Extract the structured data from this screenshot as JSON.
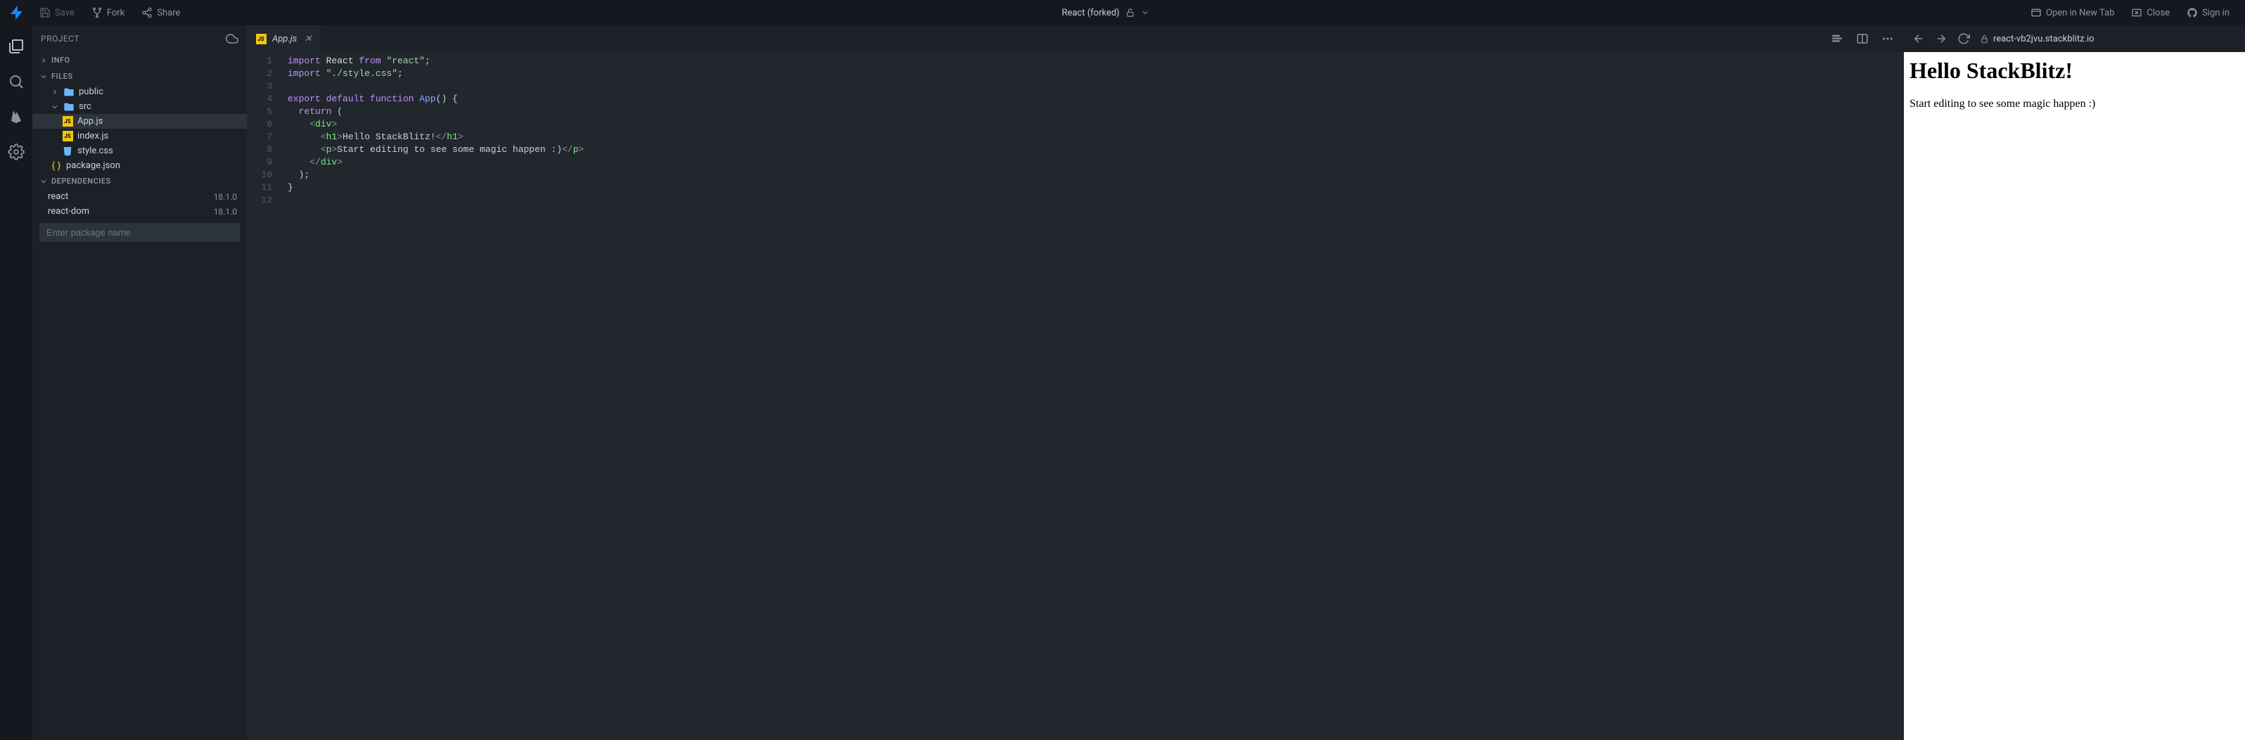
{
  "topbar": {
    "save": "Save",
    "fork": "Fork",
    "share": "Share",
    "project_title": "React (forked)",
    "open_new_tab": "Open in New Tab",
    "close": "Close",
    "signin": "Sign in"
  },
  "sidebar": {
    "header": "PROJECT",
    "sections": {
      "info": "INFO",
      "files": "FILES",
      "deps": "DEPENDENCIES"
    },
    "tree": {
      "public": "public",
      "src": "src",
      "app_js": "App.js",
      "index_js": "index.js",
      "style_css": "style.css",
      "package_json": "package.json"
    },
    "deps": [
      {
        "name": "react",
        "version": "18.1.0"
      },
      {
        "name": "react-dom",
        "version": "18.1.0"
      }
    ],
    "pkg_placeholder": "Enter package name"
  },
  "editor": {
    "tab_name": "App.js",
    "line_numbers": [
      "1",
      "2",
      "3",
      "4",
      "5",
      "6",
      "7",
      "8",
      "9",
      "10",
      "11",
      "12"
    ],
    "lines": [
      [
        [
          "import ",
          "tk-kw"
        ],
        [
          "React ",
          "tk-var"
        ],
        [
          "from ",
          "tk-kw"
        ],
        [
          "\"react\"",
          "tk-str"
        ],
        [
          ";",
          "tk-txt"
        ]
      ],
      [
        [
          "import ",
          "tk-kw"
        ],
        [
          "\"./style.css\"",
          "tk-str"
        ],
        [
          ";",
          "tk-txt"
        ]
      ],
      [
        [
          "",
          ""
        ]
      ],
      [
        [
          "export default ",
          "tk-kw"
        ],
        [
          "function ",
          "tk-kw"
        ],
        [
          "App",
          "tk-fn"
        ],
        [
          "() {",
          "tk-txt"
        ]
      ],
      [
        [
          "  ",
          ""
        ],
        [
          "return ",
          "tk-kw"
        ],
        [
          "(",
          "tk-txt"
        ]
      ],
      [
        [
          "    ",
          ""
        ],
        [
          "<",
          "tk-br"
        ],
        [
          "div",
          "tk-tag"
        ],
        [
          ">",
          "tk-br"
        ]
      ],
      [
        [
          "      ",
          ""
        ],
        [
          "<",
          "tk-br"
        ],
        [
          "h1",
          "tk-tag"
        ],
        [
          ">",
          "tk-br"
        ],
        [
          "Hello StackBlitz!",
          "tk-txt"
        ],
        [
          "</",
          "tk-br"
        ],
        [
          "h1",
          "tk-tag"
        ],
        [
          ">",
          "tk-br"
        ]
      ],
      [
        [
          "      ",
          ""
        ],
        [
          "<",
          "tk-br"
        ],
        [
          "p",
          "tk-tag"
        ],
        [
          ">",
          "tk-br"
        ],
        [
          "Start editing to see some magic happen :)",
          "tk-txt"
        ],
        [
          "</",
          "tk-br"
        ],
        [
          "p",
          "tk-tag"
        ],
        [
          ">",
          "tk-br"
        ]
      ],
      [
        [
          "    ",
          ""
        ],
        [
          "</",
          "tk-br"
        ],
        [
          "div",
          "tk-tag"
        ],
        [
          ">",
          "tk-br"
        ]
      ],
      [
        [
          "  );",
          "tk-txt"
        ]
      ],
      [
        [
          "}",
          "tk-txt"
        ]
      ],
      [
        [
          "",
          ""
        ]
      ]
    ]
  },
  "preview": {
    "url": "react-vb2jvu.stackblitz.io",
    "h1": "Hello StackBlitz!",
    "p": "Start editing to see some magic happen :)"
  }
}
